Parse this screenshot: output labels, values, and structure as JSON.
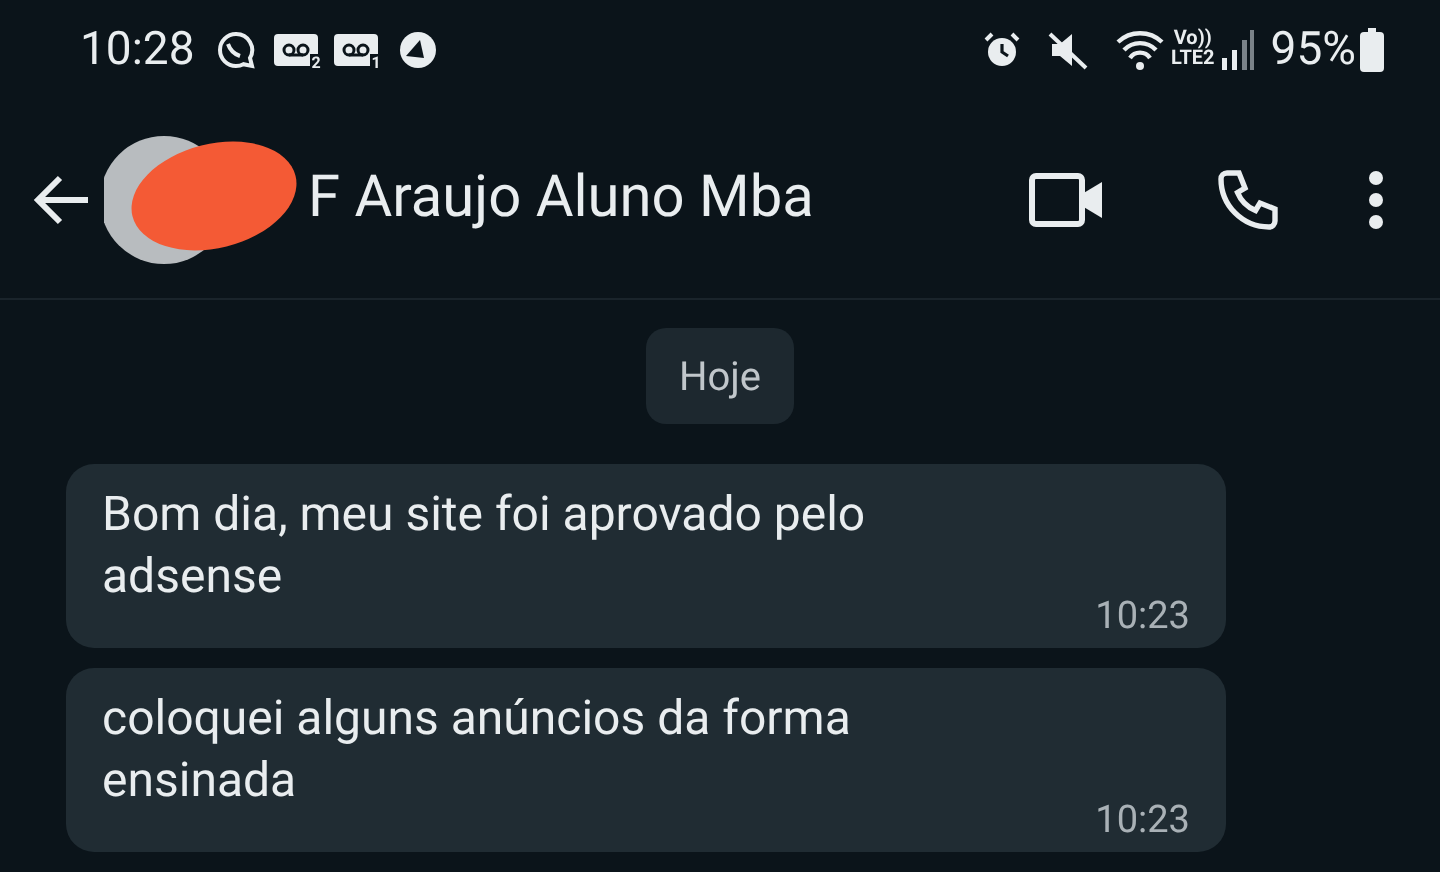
{
  "status_bar": {
    "time": "10:28",
    "voicemail_badges": [
      "2",
      "1"
    ],
    "network": {
      "volte": "Vo))",
      "lte": "LTE2"
    },
    "battery": "95%"
  },
  "header": {
    "contact_name": "F Araujo Aluno Mba"
  },
  "chat": {
    "date_chip": "Hoje",
    "messages": [
      {
        "text": "Bom dia, meu site foi aprovado pelo adsense",
        "time": "10:23"
      },
      {
        "text": "coloquei alguns anúncios da forma ensinada",
        "time": "10:23"
      }
    ]
  }
}
